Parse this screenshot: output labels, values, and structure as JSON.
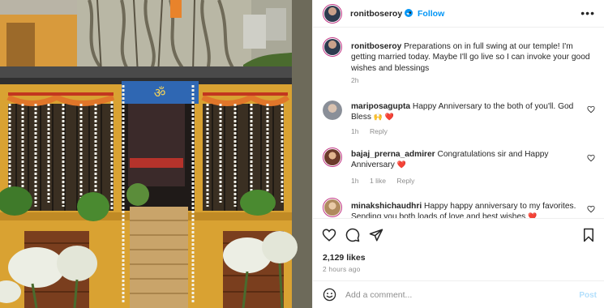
{
  "colors": {
    "accent": "#0095f6",
    "like_red": "#ed4956",
    "text": "#262626",
    "muted": "#8e8e8e"
  },
  "post": {
    "image_alt": "Decorated temple entrance with flower garlands, marigolds and potted plants",
    "author": {
      "username": "ronitboseroy",
      "verified": true,
      "follow_label": "Follow",
      "dot": "•"
    },
    "more_icon": "more-horizontal-icon"
  },
  "caption": {
    "username": "ronitboseroy",
    "text": "Preparations on in full swing at our temple! I'm getting married today. Maybe I'll go live so I can invoke your good wishes and blessings",
    "time": "2h"
  },
  "comments": [
    {
      "username": "mariposagupta",
      "text": "Happy Anniversary to the both of you'll. God Bless",
      "emoji": "🙌 ❤️",
      "time": "1h",
      "likes": "",
      "reply": "Reply"
    },
    {
      "username": "bajaj_prerna_admirer",
      "text": "Congratulations sir and Happy Anniversary",
      "emoji": "❤️",
      "time": "1h",
      "likes": "1 like",
      "reply": "Reply"
    },
    {
      "username": "minakshichaudhri",
      "text": "Happy happy anniversary to my favorites. Sending you both loads of love and best wishes",
      "emoji": "❤️",
      "time": "",
      "likes": "",
      "reply": ""
    }
  ],
  "actions": {
    "like_icon": "heart-icon",
    "comment_icon": "comment-icon",
    "share_icon": "send-icon",
    "save_icon": "bookmark-icon",
    "likes_count": "2,129 likes",
    "posted_ago": "2 hours ago"
  },
  "add_comment": {
    "placeholder": "Add a comment...",
    "post_label": "Post",
    "emoji_icon": "smiley-icon"
  }
}
